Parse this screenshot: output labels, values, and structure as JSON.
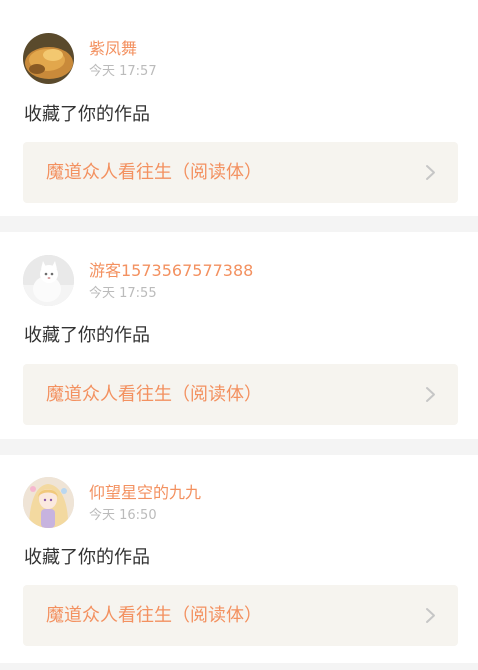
{
  "feed": {
    "items": [
      {
        "user": "紫凤舞",
        "time": "今天 17:57",
        "action": "收藏了你的作品",
        "work_title": "魔道众人看往生（阅读体）",
        "avatar_icon": "food-photo-avatar"
      },
      {
        "user": "游客1573567577388",
        "time": "今天 17:55",
        "action": "收藏了你的作品",
        "work_title": "魔道众人看往生（阅读体）",
        "avatar_icon": "white-cat-avatar"
      },
      {
        "user": "仰望星空的九九",
        "time": "今天 16:50",
        "action": "收藏了你的作品",
        "work_title": "魔道众人看往生（阅读体）",
        "avatar_icon": "anime-girl-avatar"
      }
    ]
  },
  "colors": {
    "accent": "#f39160",
    "tab_indicator": "#e85a9b",
    "link_background": "#f6f4ef",
    "timestamp": "#bbbbbb",
    "separator": "#f4f4f4"
  }
}
